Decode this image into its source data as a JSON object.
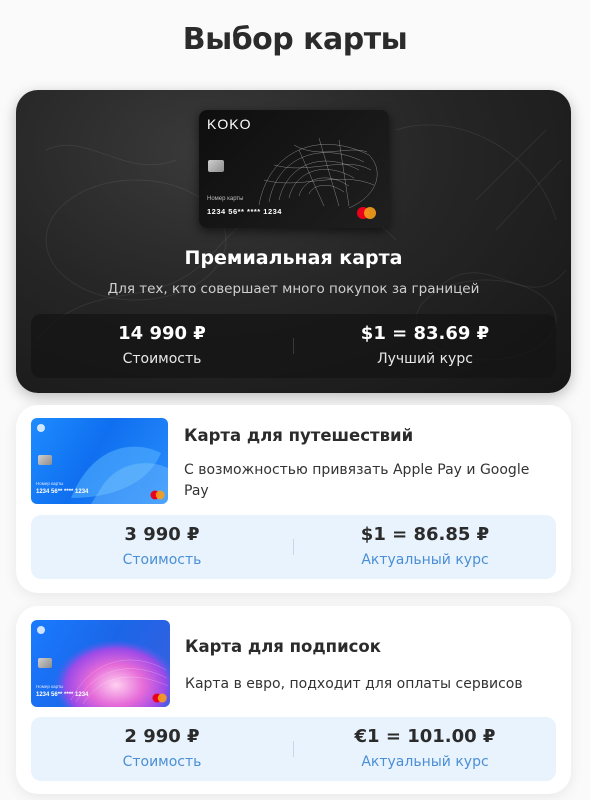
{
  "page": {
    "title": "Выбор карты"
  },
  "premium": {
    "card_image": {
      "brand": "KOKO",
      "number_label": "Номер карты",
      "number": "1234  56**  ****  1234"
    },
    "title": "Премиальная карта",
    "description": "Для тех, кто совершает много покупок за границей",
    "price": "14 990 ₽",
    "price_label": "Стоимость",
    "rate": "$1 = 83.69 ₽",
    "rate_label": "Лучший курс"
  },
  "travel": {
    "card_image": {
      "number_label": "Номер карты",
      "number": "1234  56**  ****  1234"
    },
    "title": "Карта для путешествий",
    "description": "С возможностью привязать Apple Pay и Google Pay",
    "price": "3 990 ₽",
    "price_label": "Стоимость",
    "rate": "$1 = 86.85 ₽",
    "rate_label": "Актуальный курс"
  },
  "subs": {
    "card_image": {
      "number_label": "Номер карты",
      "number": "1234  56**  ****  1234"
    },
    "title": "Карта для подписок",
    "description": "Карта в евро, подходит для оплаты сервисов",
    "price": "2 990 ₽",
    "price_label": "Стоимость",
    "rate": "€1 = 101.00 ₽",
    "rate_label": "Актуальный курс"
  },
  "colors": {
    "premium_bg": "#1e1e1e",
    "stats_bg_light": "#e9f3fd",
    "accent_blue": "#4a8fd6",
    "mastercard_red": "#eb001b",
    "mastercard_orange": "#f79e1b"
  },
  "icons": [
    "chip-icon",
    "mastercard-icon",
    "bank-logo-icon"
  ]
}
